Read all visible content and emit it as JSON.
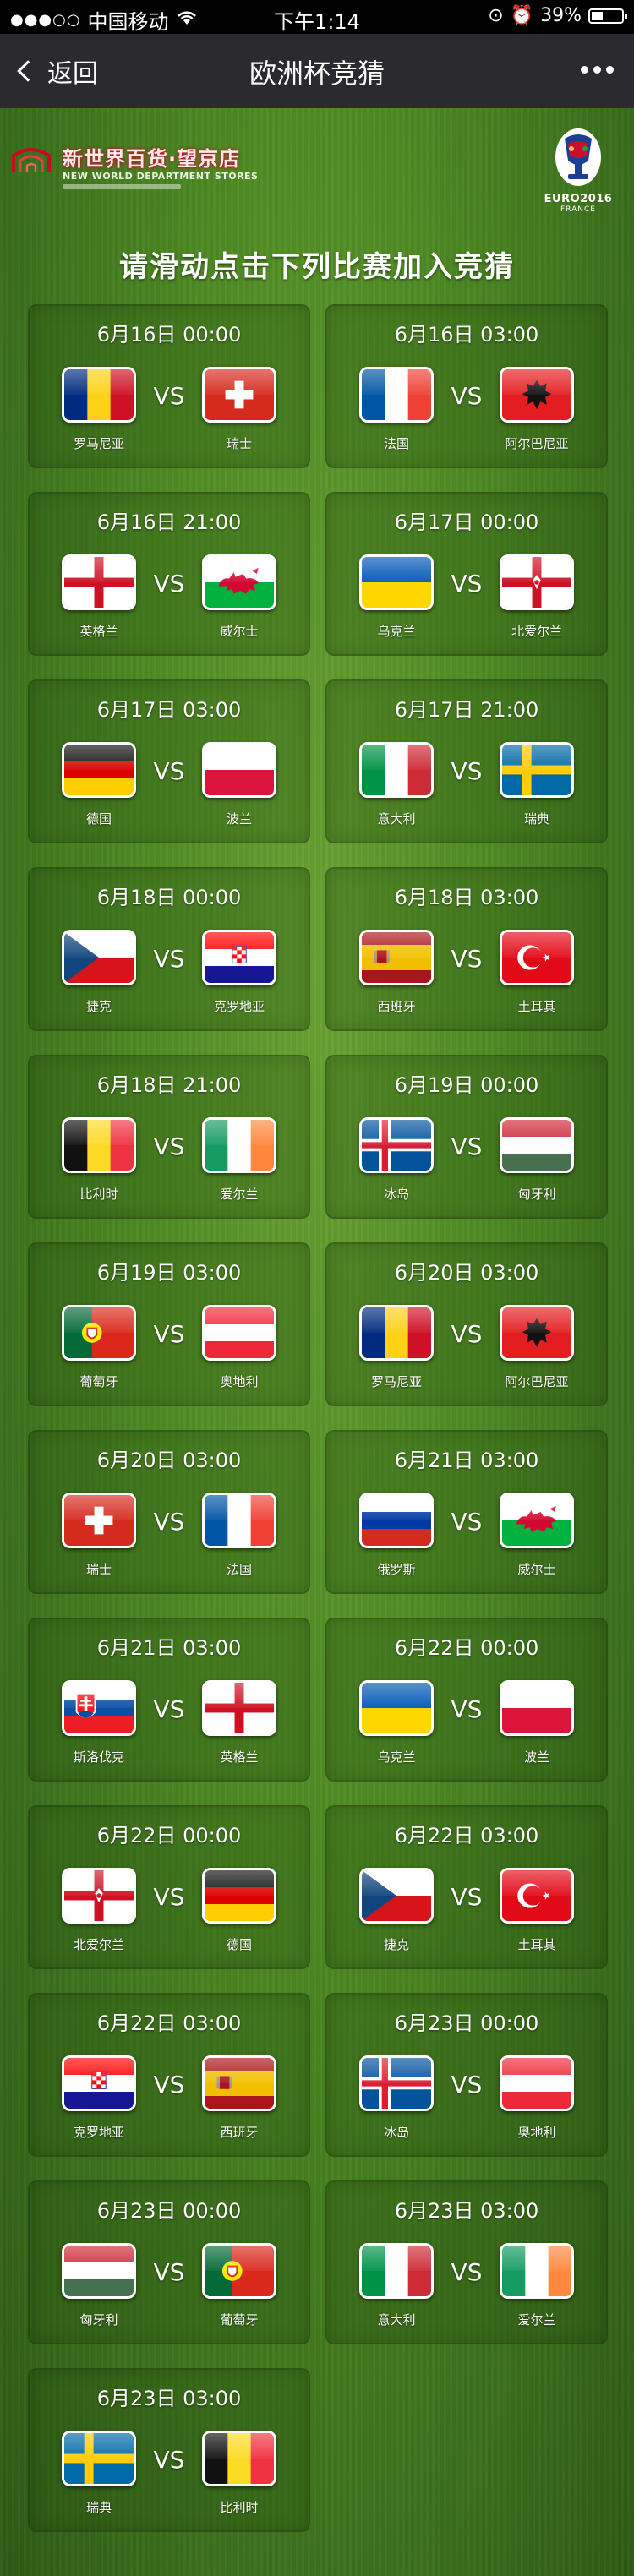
{
  "status_bar": {
    "carrier": "中国移动",
    "time": "下午1:14",
    "battery": "39%",
    "battery_level": 0.39
  },
  "nav": {
    "back_label": "返回",
    "title": "欧洲杯竞猜"
  },
  "header": {
    "store_name": "新世界百货·望京店",
    "store_english": "NEW WORLD DEPARTMENT STORES",
    "euro_text": "EURO2016",
    "euro_country": "FRANCE",
    "instruction": "请滑动点击下列比赛加入竞猜"
  },
  "vs_label": "VS",
  "matches": [
    {
      "datetime": "6月16日 00:00",
      "home": "罗马尼亚",
      "away": "瑞士",
      "home_flag": "romania",
      "away_flag": "switzerland"
    },
    {
      "datetime": "6月16日 03:00",
      "home": "法国",
      "away": "阿尔巴尼亚",
      "home_flag": "france",
      "away_flag": "albania"
    },
    {
      "datetime": "6月16日 21:00",
      "home": "英格兰",
      "away": "威尔士",
      "home_flag": "england",
      "away_flag": "wales"
    },
    {
      "datetime": "6月17日 00:00",
      "home": "乌克兰",
      "away": "北爱尔兰",
      "home_flag": "ukraine",
      "away_flag": "northern-ireland"
    },
    {
      "datetime": "6月17日 03:00",
      "home": "德国",
      "away": "波兰",
      "home_flag": "germany",
      "away_flag": "poland"
    },
    {
      "datetime": "6月17日 21:00",
      "home": "意大利",
      "away": "瑞典",
      "home_flag": "italy",
      "away_flag": "sweden"
    },
    {
      "datetime": "6月18日 00:00",
      "home": "捷克",
      "away": "克罗地亚",
      "home_flag": "czech",
      "away_flag": "croatia"
    },
    {
      "datetime": "6月18日 03:00",
      "home": "西班牙",
      "away": "土耳其",
      "home_flag": "spain",
      "away_flag": "turkey"
    },
    {
      "datetime": "6月18日 21:00",
      "home": "比利时",
      "away": "爱尔兰",
      "home_flag": "belgium",
      "away_flag": "ireland"
    },
    {
      "datetime": "6月19日 00:00",
      "home": "冰岛",
      "away": "匈牙利",
      "home_flag": "iceland",
      "away_flag": "hungary"
    },
    {
      "datetime": "6月19日 03:00",
      "home": "葡萄牙",
      "away": "奥地利",
      "home_flag": "portugal",
      "away_flag": "austria"
    },
    {
      "datetime": "6月20日 03:00",
      "home": "罗马尼亚",
      "away": "阿尔巴尼亚",
      "home_flag": "romania",
      "away_flag": "albania"
    },
    {
      "datetime": "6月20日 03:00",
      "home": "瑞士",
      "away": "法国",
      "home_flag": "switzerland",
      "away_flag": "france"
    },
    {
      "datetime": "6月21日 03:00",
      "home": "俄罗斯",
      "away": "威尔士",
      "home_flag": "russia",
      "away_flag": "wales"
    },
    {
      "datetime": "6月21日 03:00",
      "home": "斯洛伐克",
      "away": "英格兰",
      "home_flag": "slovakia",
      "away_flag": "england"
    },
    {
      "datetime": "6月22日 00:00",
      "home": "乌克兰",
      "away": "波兰",
      "home_flag": "ukraine",
      "away_flag": "poland"
    },
    {
      "datetime": "6月22日 00:00",
      "home": "北爱尔兰",
      "away": "德国",
      "home_flag": "northern-ireland",
      "away_flag": "germany"
    },
    {
      "datetime": "6月22日 03:00",
      "home": "捷克",
      "away": "土耳其",
      "home_flag": "czech",
      "away_flag": "turkey"
    },
    {
      "datetime": "6月22日 03:00",
      "home": "克罗地亚",
      "away": "西班牙",
      "home_flag": "croatia",
      "away_flag": "spain"
    },
    {
      "datetime": "6月23日 00:00",
      "home": "冰岛",
      "away": "奥地利",
      "home_flag": "iceland",
      "away_flag": "austria"
    },
    {
      "datetime": "6月23日 00:00",
      "home": "匈牙利",
      "away": "葡萄牙",
      "home_flag": "hungary",
      "away_flag": "portugal"
    },
    {
      "datetime": "6月23日 03:00",
      "home": "意大利",
      "away": "爱尔兰",
      "home_flag": "italy",
      "away_flag": "ireland"
    },
    {
      "datetime": "6月23日 03:00",
      "home": "瑞典",
      "away": "比利时",
      "home_flag": "sweden",
      "away_flag": "belgium"
    }
  ]
}
